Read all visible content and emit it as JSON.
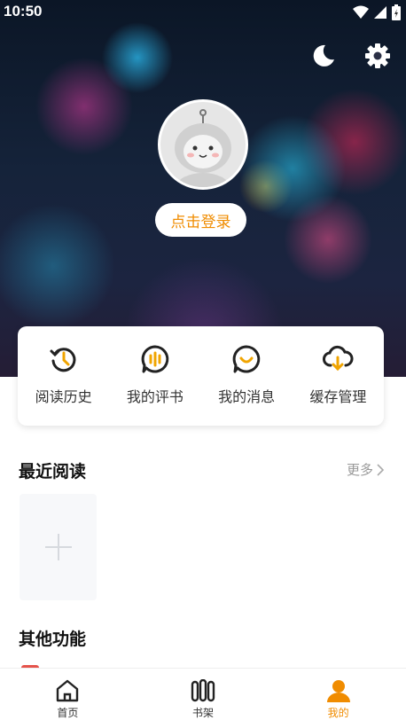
{
  "status_bar": {
    "time": "10:50"
  },
  "header": {
    "night_mode_icon": "moon-icon",
    "settings_icon": "gear-icon",
    "login_label": "点击登录"
  },
  "quick_actions": [
    {
      "label": "阅读历史",
      "icon": "history-icon"
    },
    {
      "label": "我的评书",
      "icon": "review-icon"
    },
    {
      "label": "我的消息",
      "icon": "message-icon"
    },
    {
      "label": "缓存管理",
      "icon": "cloud-download-icon"
    }
  ],
  "recent": {
    "title": "最近阅读",
    "more_label": "更多"
  },
  "other": {
    "title": "其他功能"
  },
  "tabbar": {
    "items": [
      {
        "label": "首页",
        "icon": "home-icon"
      },
      {
        "label": "书架",
        "icon": "bookshelf-icon"
      },
      {
        "label": "我的",
        "icon": "profile-icon"
      }
    ],
    "active": "我的"
  },
  "colors": {
    "accent": "#f08c00",
    "text": "#333333",
    "muted": "#999999"
  }
}
